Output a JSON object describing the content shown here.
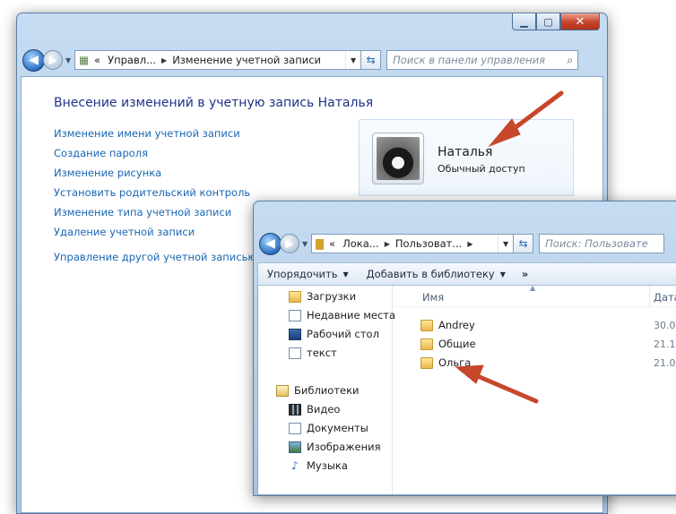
{
  "win1": {
    "nav": {
      "back_glyph": "◀",
      "address": [
        "«",
        "Управл...",
        "Изменение учетной записи"
      ],
      "search_placeholder": "Поиск в панели управления"
    },
    "caption": {
      "min": "▁",
      "max": "▢",
      "close": "✕"
    },
    "title": "Внесение изменений в учетную запись Наталья",
    "links": [
      "Изменение имени учетной записи",
      "Создание пароля",
      "Изменение рисунка",
      "Установить родительский контроль",
      "Изменение типа учетной записи",
      "Удаление учетной записи"
    ],
    "other_link": "Управление другой учетной записью",
    "account": {
      "name": "Наталья",
      "type": "Обычный доступ"
    }
  },
  "win2": {
    "nav": {
      "address": [
        "«",
        "Лока...",
        "Пользоват..."
      ],
      "search_placeholder": "Поиск: Пользовате"
    },
    "toolbar": {
      "organize": "Упорядочить",
      "add_to_library": "Добавить в библиотеку",
      "more": "»"
    },
    "navpane": {
      "favorites": [
        "Загрузки",
        "Недавние места",
        "Рабочий стол",
        "текст"
      ],
      "libraries_label": "Библиотеки",
      "libraries": [
        "Видео",
        "Документы",
        "Изображения",
        "Музыка"
      ]
    },
    "columns": {
      "name": "Имя",
      "date": "Дата"
    },
    "files": [
      {
        "name": "Andrey",
        "date": "30.0"
      },
      {
        "name": "Общие",
        "date": "21.1"
      },
      {
        "name": "Ольга",
        "date": "21.0"
      }
    ]
  },
  "colors": {
    "arrow": "#c7472a",
    "link": "#1a66b3",
    "title": "#1e3287"
  }
}
